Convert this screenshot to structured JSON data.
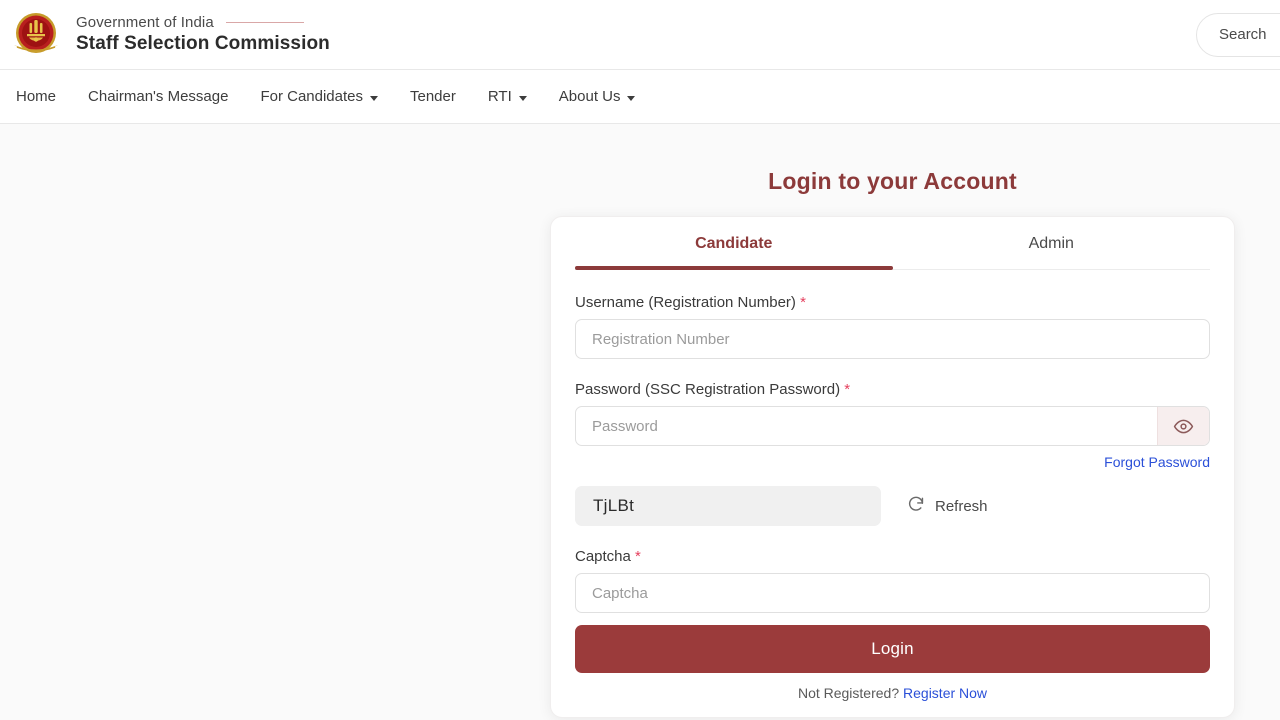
{
  "header": {
    "emblem_icon": "india-national-emblem-icon",
    "gov_label": "Government of India",
    "org_label": "Staff Selection Commission",
    "right_pill_label": "Search"
  },
  "nav": {
    "items": [
      {
        "label": "Home",
        "has_caret": false
      },
      {
        "label": "Chairman's Message",
        "has_caret": false
      },
      {
        "label": "For Candidates",
        "has_caret": true
      },
      {
        "label": "Tender",
        "has_caret": false
      },
      {
        "label": "RTI",
        "has_caret": true
      },
      {
        "label": "About Us",
        "has_caret": true
      }
    ]
  },
  "main": {
    "page_title": "Login to your Account",
    "tabs": [
      {
        "label": "Candidate",
        "active": true
      },
      {
        "label": "Admin",
        "active": false
      }
    ],
    "form": {
      "username": {
        "label": "Username (Registration Number)",
        "required_mark": "*",
        "placeholder": "Registration Number",
        "value": ""
      },
      "password": {
        "label": "Password (SSC Registration Password)",
        "required_mark": "*",
        "placeholder": "Password",
        "value": "",
        "toggle_icon": "eye-icon"
      },
      "forgot_password_label": "Forgot Password",
      "captcha_code": "TjLBt",
      "refresh_label": "Refresh",
      "refresh_icon": "refresh-icon",
      "captcha": {
        "label": "Captcha",
        "required_mark": "*",
        "placeholder": "Captcha",
        "value": ""
      },
      "login_button_label": "Login",
      "register_prompt": "Not Registered?",
      "register_link_label": "Register Now"
    }
  },
  "colors": {
    "brand_maroon": "#8c3a3a",
    "button_maroon": "#9b3b3b",
    "link_blue": "#2b50d8",
    "required_red": "#e5405e",
    "page_bg": "#fafafa"
  }
}
